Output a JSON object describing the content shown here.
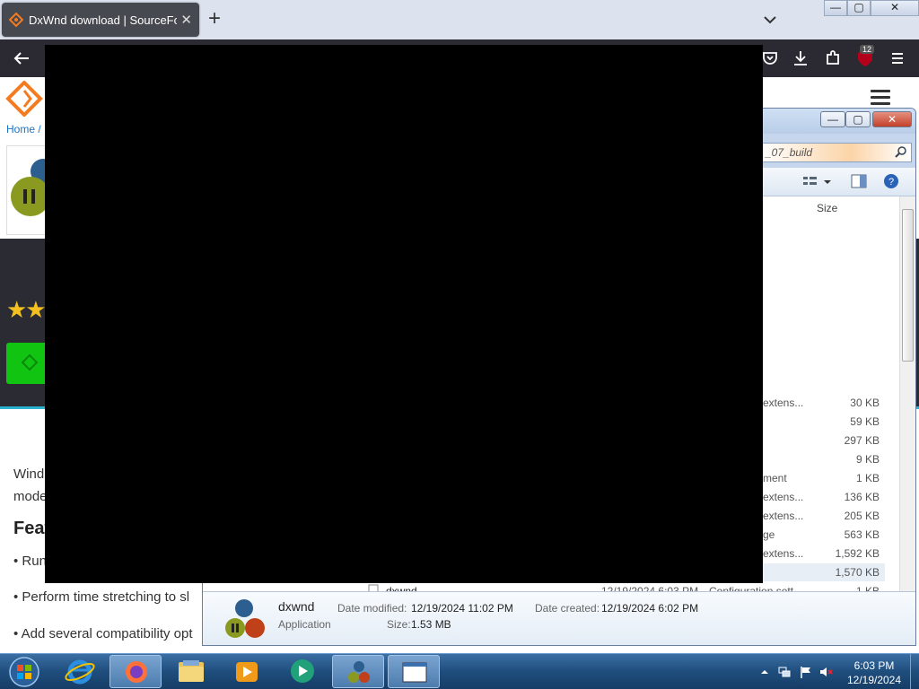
{
  "browser": {
    "tab_title": "DxWnd download | SourceForge",
    "tab_close": "✕",
    "new_tab": "+",
    "toolbar_badge": "12"
  },
  "window_controls": {
    "minimize": "—",
    "maximize": "▢",
    "close": "✕"
  },
  "page": {
    "breadcrumb": "Home /",
    "stars": "★★",
    "description_line1": "Wind",
    "description_line2": "mode",
    "features_heading": "Feat",
    "features": [
      "• Run",
      "• Perform time stretching to sl",
      "• Add several compatibility opt"
    ]
  },
  "explorer": {
    "address_text": "_07_build",
    "column_size": "Size",
    "controls": {
      "minimize": "—",
      "maximize": "▢",
      "close": "✕"
    },
    "rows": [
      {
        "type": "extens...",
        "size": "30 KB"
      },
      {
        "type": "",
        "size": "59 KB"
      },
      {
        "type": "",
        "size": "297 KB"
      },
      {
        "type": "",
        "size": "9 KB"
      },
      {
        "type": "ment",
        "size": "1 KB"
      },
      {
        "type": "extens...",
        "size": "136 KB"
      },
      {
        "type": "extens...",
        "size": "205 KB"
      },
      {
        "type": "ge",
        "size": "563 KB"
      },
      {
        "type": "extens...",
        "size": "1,592 KB"
      },
      {
        "type": "",
        "size": "1,570 KB"
      }
    ],
    "partial_row": {
      "name": "dxwnd",
      "date": "12/19/2024 6:03 PM",
      "type": "Configuration sett...",
      "size": "1 KB"
    },
    "details": {
      "name": "dxwnd",
      "kind": "Application",
      "date_modified_label": "Date modified:",
      "date_modified": "12/19/2024 11:02 PM",
      "size_label": "Size:",
      "size": "1.53 MB",
      "date_created_label": "Date created:",
      "date_created": "12/19/2024 6:02 PM"
    }
  },
  "taskbar": {
    "time": "6:03 PM",
    "date": "12/19/2024"
  },
  "colors": {
    "sf_orange": "#f47b20",
    "download_green": "#12c412",
    "accent_cyan": "#2ab3d0"
  }
}
